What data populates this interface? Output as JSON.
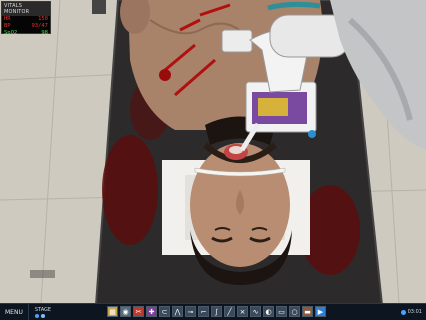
{
  "vitals_monitor": {
    "title": "VITALS MONITOR",
    "rows": [
      {
        "label": "HR",
        "value": "150"
      },
      {
        "label": "BP",
        "value": "93/47"
      },
      {
        "label": "SpO2",
        "value": "98"
      }
    ]
  },
  "toolbar": {
    "menu_label": "MENU",
    "stage_label": "STAGE",
    "tools": [
      {
        "icon": "gauze-pad-icon",
        "glyph": "▦",
        "color": "#c9a24a"
      },
      {
        "icon": "bag-valve-mask-icon",
        "glyph": "◉",
        "color": "#5a6b7a"
      },
      {
        "icon": "scalpel-icon",
        "glyph": "✂",
        "color": "#c0392b"
      },
      {
        "icon": "syringe-icon",
        "glyph": "✚",
        "color": "#7d3c98"
      },
      {
        "icon": "stethoscope-icon",
        "glyph": "⊂",
        "color": "#3a4a5a"
      },
      {
        "icon": "forceps-icon",
        "glyph": "⋀",
        "color": "#3a4a5a"
      },
      {
        "icon": "endotracheal-tube-icon",
        "glyph": "⊸",
        "color": "#3a4a5a"
      },
      {
        "icon": "laryngoscope-icon",
        "glyph": "⌐",
        "color": "#3a4a5a"
      },
      {
        "icon": "suction-icon",
        "glyph": "∫",
        "color": "#3a4a5a"
      },
      {
        "icon": "tube-icon",
        "glyph": "╱",
        "color": "#3a4a5a"
      },
      {
        "icon": "clamp-icon",
        "glyph": "⨯",
        "color": "#3a4a5a"
      },
      {
        "icon": "catheter-icon",
        "glyph": "∿",
        "color": "#3a4a5a"
      },
      {
        "icon": "monitor-lead-icon",
        "glyph": "◐",
        "color": "#3a4a5a"
      },
      {
        "icon": "tape-icon",
        "glyph": "▭",
        "color": "#3a4a5a"
      },
      {
        "icon": "oxygen-icon",
        "glyph": "○",
        "color": "#3a4a5a"
      },
      {
        "icon": "bandage-icon",
        "glyph": "▬",
        "color": "#8b5a3c"
      },
      {
        "icon": "next-arrow-icon",
        "glyph": "▶",
        "color": "#2f7fd6"
      }
    ],
    "timer": "03:01"
  }
}
